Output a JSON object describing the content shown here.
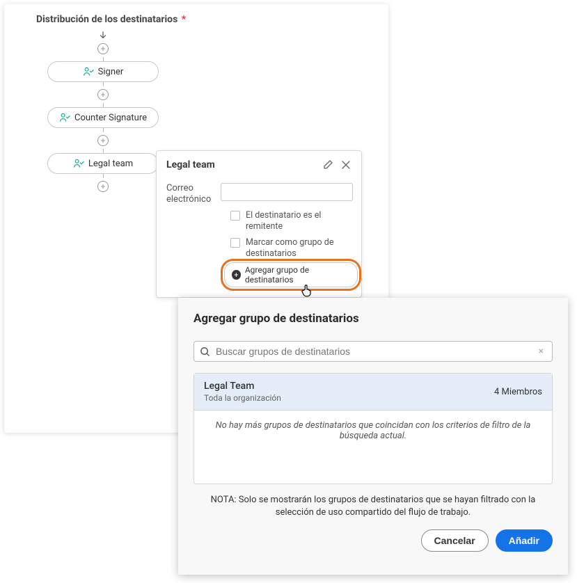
{
  "section": {
    "title": "Distribución de los destinatarios",
    "required_mark": "*"
  },
  "flow": {
    "nodes": [
      {
        "label": "Signer"
      },
      {
        "label": "Counter Signature"
      },
      {
        "label": "Legal team"
      }
    ]
  },
  "popout": {
    "title": "Legal team",
    "email_label": "Correo electrónico",
    "email_value": "",
    "chk_sender": "El destinatario es el remitente",
    "chk_group": "Marcar como grupo de destinatarios",
    "add_group_button": "Agregar grupo de destinatarios"
  },
  "modal": {
    "title": "Agregar grupo de destinatarios",
    "search_placeholder": "Buscar grupos de destinatarios",
    "result": {
      "name": "Legal Team",
      "scope": "Toda la organización",
      "members": "4 Miembros"
    },
    "no_more": "No hay más grupos de destinatarios que coincidan con los criterios de filtro de la búsqueda actual.",
    "note": "NOTA: Solo se mostrarán los grupos de destinatarios que se hayan filtrado con la selección de uso compartido del flujo de trabajo.",
    "cancel": "Cancelar",
    "add": "Añadir"
  }
}
